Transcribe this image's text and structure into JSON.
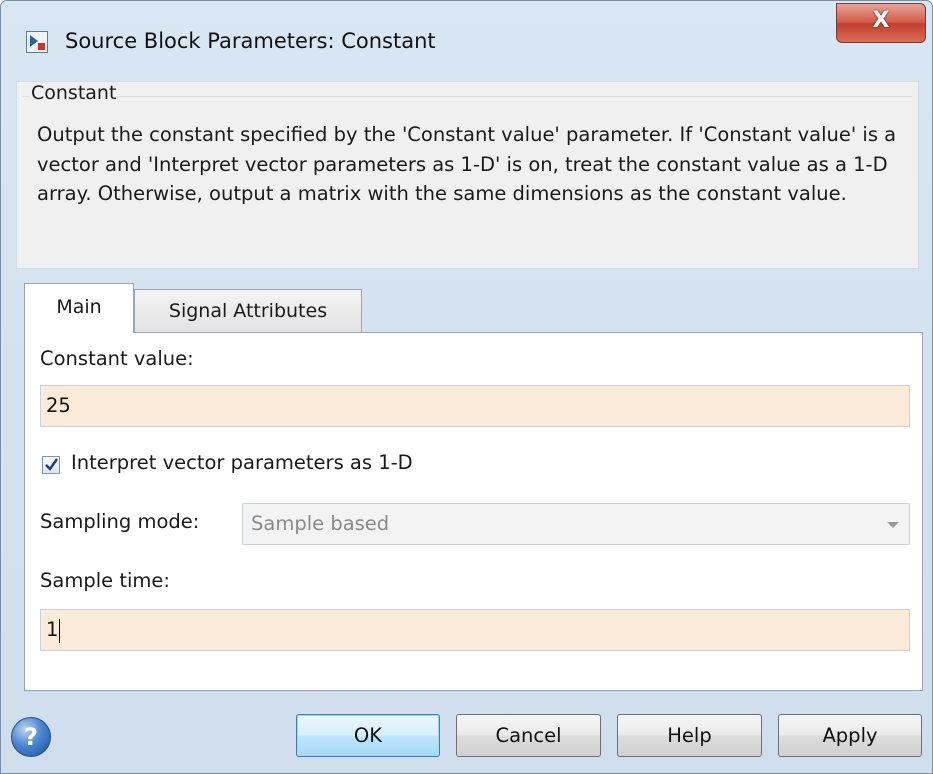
{
  "window": {
    "title": "Source Block Parameters: Constant",
    "close_label": "X"
  },
  "description": {
    "group_title": "Constant",
    "text": "Output the constant specified by the 'Constant value' parameter. If 'Constant value' is a vector and 'Interpret vector parameters as 1-D' is on, treat the constant value as a 1-D array. Otherwise, output a matrix with the same dimensions as the constant value."
  },
  "tabs": [
    {
      "label": "Main",
      "active": true
    },
    {
      "label": "Signal Attributes",
      "active": false
    }
  ],
  "main": {
    "constant_value_label": "Constant value:",
    "constant_value": "25",
    "interpret_checkbox_label": "Interpret vector parameters as 1-D",
    "interpret_checked": true,
    "sampling_mode_label": "Sampling mode:",
    "sampling_mode_value": "Sample based",
    "sample_time_label": "Sample time:",
    "sample_time_value": "1"
  },
  "buttons": {
    "help_icon": "?",
    "ok": "OK",
    "cancel": "Cancel",
    "help": "Help",
    "apply": "Apply"
  },
  "colors": {
    "field_bg": "#fcebd8",
    "ok_border": "#3c7fb1",
    "close_red": "#c2402f"
  }
}
